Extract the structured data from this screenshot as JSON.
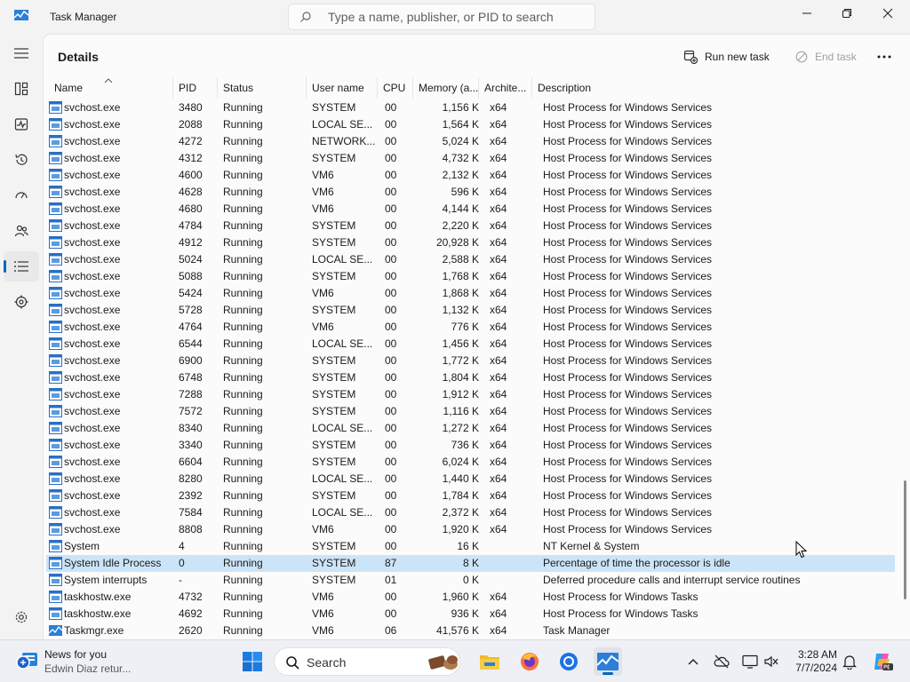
{
  "window": {
    "title": "Task Manager"
  },
  "search": {
    "placeholder": "Type a name, publisher, or PID to search"
  },
  "page": {
    "title": "Details"
  },
  "commands": {
    "run_new_task": "Run new task",
    "end_task": "End task"
  },
  "columns": [
    "Name",
    "PID",
    "Status",
    "User name",
    "CPU",
    "Memory (a...",
    "Archite...",
    "Description"
  ],
  "rows": [
    [
      "svchost.exe",
      "3480",
      "Running",
      "SYSTEM",
      "00",
      "1,156 K",
      "x64",
      "Host Process for Windows Services"
    ],
    [
      "svchost.exe",
      "2088",
      "Running",
      "LOCAL SE...",
      "00",
      "1,564 K",
      "x64",
      "Host Process for Windows Services"
    ],
    [
      "svchost.exe",
      "4272",
      "Running",
      "NETWORK...",
      "00",
      "5,024 K",
      "x64",
      "Host Process for Windows Services"
    ],
    [
      "svchost.exe",
      "4312",
      "Running",
      "SYSTEM",
      "00",
      "4,732 K",
      "x64",
      "Host Process for Windows Services"
    ],
    [
      "svchost.exe",
      "4600",
      "Running",
      "VM6",
      "00",
      "2,132 K",
      "x64",
      "Host Process for Windows Services"
    ],
    [
      "svchost.exe",
      "4628",
      "Running",
      "VM6",
      "00",
      "596 K",
      "x64",
      "Host Process for Windows Services"
    ],
    [
      "svchost.exe",
      "4680",
      "Running",
      "VM6",
      "00",
      "4,144 K",
      "x64",
      "Host Process for Windows Services"
    ],
    [
      "svchost.exe",
      "4784",
      "Running",
      "SYSTEM",
      "00",
      "2,220 K",
      "x64",
      "Host Process for Windows Services"
    ],
    [
      "svchost.exe",
      "4912",
      "Running",
      "SYSTEM",
      "00",
      "20,928 K",
      "x64",
      "Host Process for Windows Services"
    ],
    [
      "svchost.exe",
      "5024",
      "Running",
      "LOCAL SE...",
      "00",
      "2,588 K",
      "x64",
      "Host Process for Windows Services"
    ],
    [
      "svchost.exe",
      "5088",
      "Running",
      "SYSTEM",
      "00",
      "1,768 K",
      "x64",
      "Host Process for Windows Services"
    ],
    [
      "svchost.exe",
      "5424",
      "Running",
      "VM6",
      "00",
      "1,868 K",
      "x64",
      "Host Process for Windows Services"
    ],
    [
      "svchost.exe",
      "5728",
      "Running",
      "SYSTEM",
      "00",
      "1,132 K",
      "x64",
      "Host Process for Windows Services"
    ],
    [
      "svchost.exe",
      "4764",
      "Running",
      "VM6",
      "00",
      "776 K",
      "x64",
      "Host Process for Windows Services"
    ],
    [
      "svchost.exe",
      "6544",
      "Running",
      "LOCAL SE...",
      "00",
      "1,456 K",
      "x64",
      "Host Process for Windows Services"
    ],
    [
      "svchost.exe",
      "6900",
      "Running",
      "SYSTEM",
      "00",
      "1,772 K",
      "x64",
      "Host Process for Windows Services"
    ],
    [
      "svchost.exe",
      "6748",
      "Running",
      "SYSTEM",
      "00",
      "1,804 K",
      "x64",
      "Host Process for Windows Services"
    ],
    [
      "svchost.exe",
      "7288",
      "Running",
      "SYSTEM",
      "00",
      "1,912 K",
      "x64",
      "Host Process for Windows Services"
    ],
    [
      "svchost.exe",
      "7572",
      "Running",
      "SYSTEM",
      "00",
      "1,116 K",
      "x64",
      "Host Process for Windows Services"
    ],
    [
      "svchost.exe",
      "8340",
      "Running",
      "LOCAL SE...",
      "00",
      "1,272 K",
      "x64",
      "Host Process for Windows Services"
    ],
    [
      "svchost.exe",
      "3340",
      "Running",
      "SYSTEM",
      "00",
      "736 K",
      "x64",
      "Host Process for Windows Services"
    ],
    [
      "svchost.exe",
      "6604",
      "Running",
      "SYSTEM",
      "00",
      "6,024 K",
      "x64",
      "Host Process for Windows Services"
    ],
    [
      "svchost.exe",
      "8280",
      "Running",
      "LOCAL SE...",
      "00",
      "1,440 K",
      "x64",
      "Host Process for Windows Services"
    ],
    [
      "svchost.exe",
      "2392",
      "Running",
      "SYSTEM",
      "00",
      "1,784 K",
      "x64",
      "Host Process for Windows Services"
    ],
    [
      "svchost.exe",
      "7584",
      "Running",
      "LOCAL SE...",
      "00",
      "2,372 K",
      "x64",
      "Host Process for Windows Services"
    ],
    [
      "svchost.exe",
      "8808",
      "Running",
      "VM6",
      "00",
      "1,920 K",
      "x64",
      "Host Process for Windows Services"
    ],
    [
      "System",
      "4",
      "Running",
      "SYSTEM",
      "00",
      "16 K",
      "",
      "NT Kernel & System"
    ],
    [
      "System Idle Process",
      "0",
      "Running",
      "SYSTEM",
      "87",
      "8 K",
      "",
      "Percentage of time the processor is idle"
    ],
    [
      "System interrupts",
      "-",
      "Running",
      "SYSTEM",
      "01",
      "0 K",
      "",
      "Deferred procedure calls and interrupt service routines"
    ],
    [
      "taskhostw.exe",
      "4732",
      "Running",
      "VM6",
      "00",
      "1,960 K",
      "x64",
      "Host Process for Windows Tasks"
    ],
    [
      "taskhostw.exe",
      "4692",
      "Running",
      "VM6",
      "00",
      "936 K",
      "x64",
      "Host Process for Windows Tasks"
    ],
    [
      "Taskmgr.exe",
      "2620",
      "Running",
      "VM6",
      "06",
      "41,576 K",
      "x64",
      "Task Manager"
    ]
  ],
  "selected_row": 27,
  "taskbar": {
    "news_title": "News for you",
    "news_subtitle": "Edwin Diaz retur...",
    "search_label": "Search",
    "time": "3:28 AM",
    "date": "7/7/2024"
  },
  "colors": {
    "accent": "#0067c0",
    "selection": "#cce4f7"
  }
}
